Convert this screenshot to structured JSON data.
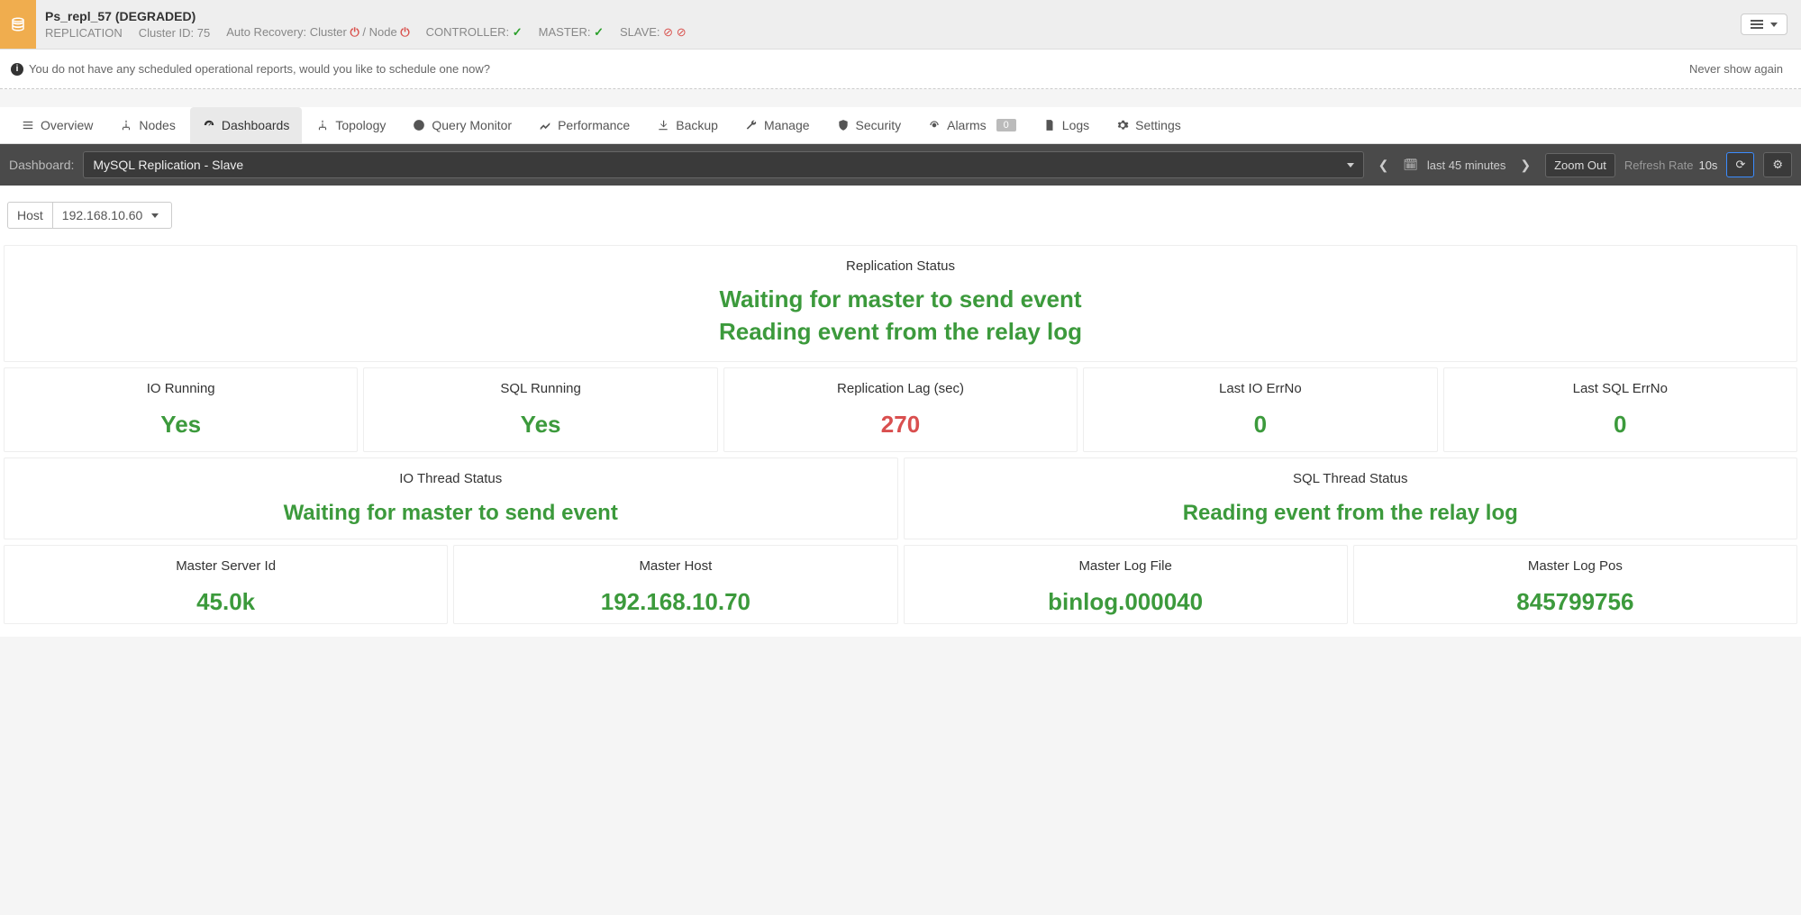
{
  "header": {
    "cluster_name": "Ps_repl_57 (DEGRADED)",
    "type_label": "REPLICATION",
    "cluster_id_label": "Cluster ID: 75",
    "auto_recovery_label": "Auto Recovery: Cluster",
    "auto_recovery_sep": "/ Node",
    "controller_label": "CONTROLLER:",
    "master_label": "MASTER:",
    "slave_label": "SLAVE:"
  },
  "alert": {
    "text": "You do not have any scheduled operational reports, would you like to schedule one now?",
    "dismiss": "Never show again"
  },
  "nav": {
    "overview": "Overview",
    "nodes": "Nodes",
    "dashboards": "Dashboards",
    "topology": "Topology",
    "query_monitor": "Query Monitor",
    "performance": "Performance",
    "backup": "Backup",
    "manage": "Manage",
    "security": "Security",
    "alarms": "Alarms",
    "alarms_count": "0",
    "logs": "Logs",
    "settings": "Settings"
  },
  "toolbar": {
    "dashboard_label": "Dashboard:",
    "dashboard_value": "MySQL Replication - Slave",
    "time_range": "last 45 minutes",
    "zoom_out": "Zoom Out",
    "refresh_label": "Refresh Rate",
    "refresh_value": "10s"
  },
  "host_picker": {
    "label": "Host",
    "value": "192.168.10.60"
  },
  "panels": {
    "replication_status": {
      "title": "Replication Status",
      "line1": "Waiting for master to send event",
      "line2": "Reading event from the relay log"
    },
    "io_running": {
      "title": "IO Running",
      "value": "Yes"
    },
    "sql_running": {
      "title": "SQL Running",
      "value": "Yes"
    },
    "replication_lag": {
      "title": "Replication Lag (sec)",
      "value": "270"
    },
    "last_io_errno": {
      "title": "Last IO ErrNo",
      "value": "0"
    },
    "last_sql_errno": {
      "title": "Last SQL ErrNo",
      "value": "0"
    },
    "io_thread_status": {
      "title": "IO Thread Status",
      "value": "Waiting for master to send event"
    },
    "sql_thread_status": {
      "title": "SQL Thread Status",
      "value": "Reading event from the relay log"
    },
    "master_server_id": {
      "title": "Master Server Id",
      "value": "45.0k"
    },
    "master_host": {
      "title": "Master Host",
      "value": "192.168.10.70"
    },
    "master_log_file": {
      "title": "Master Log File",
      "value": "binlog.000040"
    },
    "master_log_pos": {
      "title": "Master Log Pos",
      "value": "845799756"
    }
  }
}
